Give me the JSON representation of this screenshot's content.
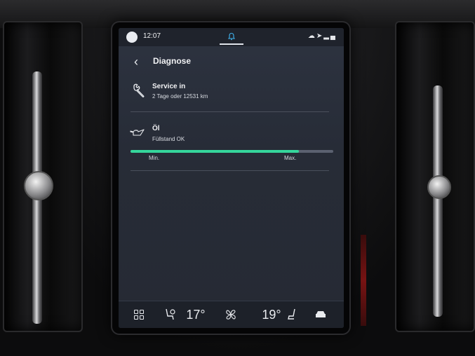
{
  "status_bar": {
    "time": "12:07",
    "icons": [
      "cloud-icon",
      "navigation-icon",
      "signal-icon"
    ]
  },
  "header": {
    "title": "Diagnose"
  },
  "service": {
    "title": "Service in",
    "detail": "2 Tage oder 12531 km",
    "icon": "wrench-icon"
  },
  "oil": {
    "title": "Öl",
    "status": "Füllstand OK",
    "icon": "oil-can-icon",
    "level_fraction": 0.83,
    "min_label": "Min.",
    "max_label": "Max.",
    "bar_color": "#35d69b"
  },
  "climate": {
    "left_temp": "17°",
    "right_temp": "19°",
    "icons": [
      "apps-grid-icon",
      "driver-seat-heat-icon",
      "fan-icon",
      "passenger-seat-icon",
      "car-icon"
    ]
  },
  "colors": {
    "screen_bg": "#2a2f3a",
    "accent_notification": "#3fb4f0"
  }
}
